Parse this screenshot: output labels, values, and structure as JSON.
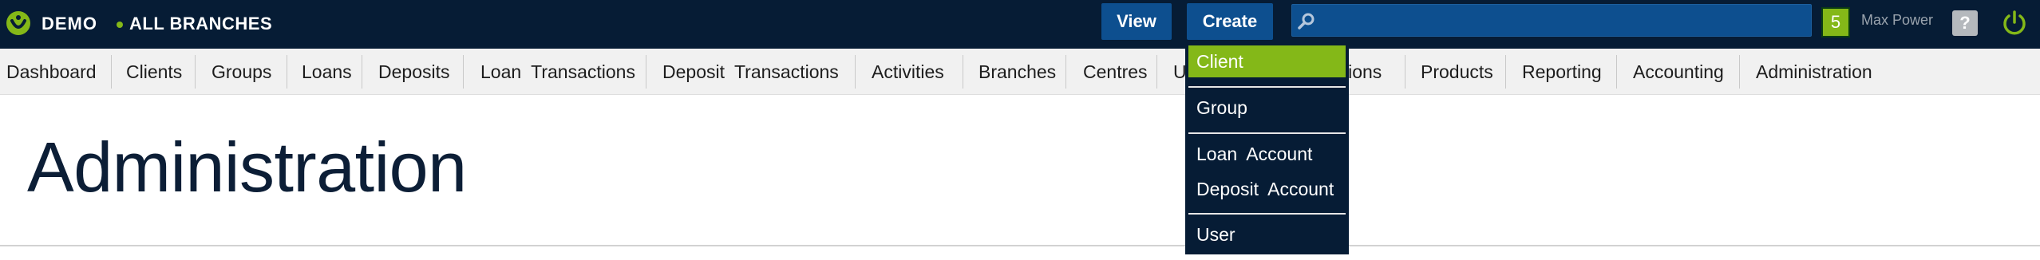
{
  "header": {
    "brand": "DEMO",
    "branch": "ALL BRANCHES",
    "view_label": "View",
    "create_label": "Create",
    "search_value": "",
    "search_placeholder": "",
    "notification_count": "5",
    "user_name": "Max Power",
    "help_label": "?",
    "accent_color": "#84b818",
    "bar_color": "#061c35",
    "button_color": "#0d4f8f"
  },
  "nav": {
    "items": [
      {
        "label": "Dashboard"
      },
      {
        "label": "Clients"
      },
      {
        "label": "Groups"
      },
      {
        "label": "Loans"
      },
      {
        "label": "Deposits"
      },
      {
        "label": "Loan  Transactions"
      },
      {
        "label": "Deposit  Transactions"
      },
      {
        "label": "Activities"
      },
      {
        "label": "Branches"
      },
      {
        "label": "Centres"
      },
      {
        "label": "Users"
      },
      {
        "label": "Communications"
      },
      {
        "label": "Products"
      },
      {
        "label": "Reporting"
      },
      {
        "label": "Accounting"
      },
      {
        "label": "Administration"
      }
    ]
  },
  "page": {
    "title": "Administration"
  },
  "create_menu": {
    "items": [
      {
        "label": "Client",
        "active": true
      },
      {
        "label": "Group"
      },
      {
        "label": "Loan  Account"
      },
      {
        "label": "Deposit  Account"
      },
      {
        "label": "User"
      }
    ]
  },
  "icons": {
    "logo": "mambu-logo-icon",
    "search": "search-icon",
    "help": "help-icon",
    "power": "power-icon"
  }
}
